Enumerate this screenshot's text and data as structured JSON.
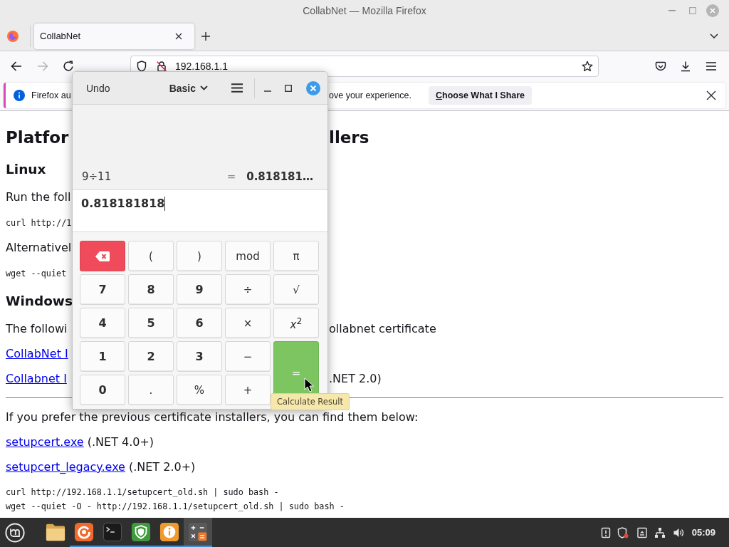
{
  "window": {
    "title": "CollabNet — Mozilla Firefox"
  },
  "tabs": [
    {
      "label": "CollabNet",
      "selected": true
    }
  ],
  "toolbar": {
    "nav_buttons": [
      {
        "kind": "back",
        "disabled": false
      },
      {
        "kind": "forward",
        "disabled": true
      },
      {
        "kind": "reload",
        "disabled": false
      }
    ],
    "url": "192.168.1.1"
  },
  "notification": {
    "text_left": "Firefox au",
    "text_right": "ove your experience.",
    "button": "Choose What I Share"
  },
  "page": {
    "blocks": [
      {
        "kind": "h1",
        "left": "Platfor",
        "right": "llers"
      },
      {
        "kind": "h2",
        "left": "Linux"
      },
      {
        "kind": "p",
        "left": "Run the foll"
      },
      {
        "kind": "code",
        "left": "curl http://1"
      },
      {
        "kind": "p",
        "left": "Alternativel"
      },
      {
        "kind": "code",
        "left": "wget --quiet"
      },
      {
        "kind": "h2",
        "left": "Windows"
      },
      {
        "kind": "p",
        "left": "The followi",
        "right": "ollabnet certificate"
      },
      {
        "kind": "link",
        "left": "CollabNet I"
      },
      {
        "kind": "link",
        "left": "Collabnet I",
        "right": ".NET 2.0)"
      },
      {
        "kind": "rule"
      },
      {
        "kind": "p",
        "text": "If you prefer the previous certificate installers, you can find them below:"
      },
      {
        "kind": "download",
        "link": "setupcert.exe",
        "note": "(.NET 4.0+)"
      },
      {
        "kind": "download",
        "link": "setupcert_legacy.exe",
        "note": "(.NET 2.0+)"
      },
      {
        "kind": "pre",
        "lines": [
          "curl http://192.168.1.1/setupcert_old.sh | sudo bash -",
          "wget --quiet -O - http://192.168.1.1/setupcert_old.sh | sudo bash -"
        ]
      }
    ]
  },
  "calculator": {
    "undo": "Undo",
    "mode": "Basic",
    "history": {
      "expression": "9÷11",
      "equals": "=",
      "result": "0.818181…"
    },
    "input": "0.818181818",
    "keys": [
      {
        "kind": "backspace"
      },
      {
        "kind": "function",
        "label": "("
      },
      {
        "kind": "function",
        "label": ")"
      },
      {
        "kind": "function",
        "label": "mod"
      },
      {
        "kind": "function",
        "label": "π"
      },
      {
        "kind": "digit",
        "label": "7"
      },
      {
        "kind": "digit",
        "label": "8"
      },
      {
        "kind": "digit",
        "label": "9"
      },
      {
        "kind": "function",
        "label": "÷"
      },
      {
        "kind": "function",
        "label": "√"
      },
      {
        "kind": "digit",
        "label": "4"
      },
      {
        "kind": "digit",
        "label": "5"
      },
      {
        "kind": "digit",
        "label": "6"
      },
      {
        "kind": "function",
        "label": "×"
      },
      {
        "kind": "function",
        "label": "*x*$^{2}$"
      },
      {
        "kind": "digit",
        "label": "1"
      },
      {
        "kind": "digit",
        "label": "2"
      },
      {
        "kind": "digit",
        "label": "3"
      },
      {
        "kind": "function",
        "label": "−"
      },
      {
        "kind": "equals",
        "label": "="
      },
      {
        "kind": "digit",
        "label": "0"
      },
      {
        "kind": "function",
        "label": "."
      },
      {
        "kind": "function",
        "label": "%"
      },
      {
        "kind": "function",
        "label": "+"
      }
    ],
    "tooltip": "Calculate Result"
  },
  "taskbar": {
    "launchers": [
      {
        "kind": "folder",
        "running": false,
        "selected": false
      },
      {
        "kind": "browser",
        "running": true,
        "selected": false
      },
      {
        "kind": "terminal",
        "running": true,
        "selected": false
      },
      {
        "kind": "shield",
        "running": true,
        "selected": false
      },
      {
        "kind": "info",
        "running": true,
        "selected": false
      },
      {
        "kind": "calculator",
        "running": true,
        "selected": true
      }
    ],
    "clock": "05:09"
  }
}
